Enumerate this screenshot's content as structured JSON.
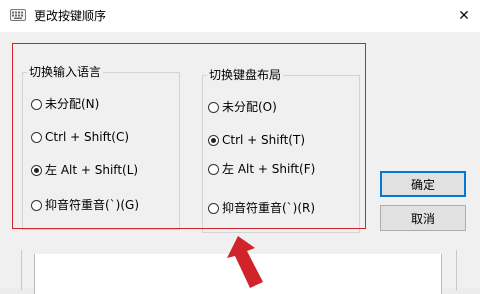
{
  "window": {
    "title": "更改按键顺序",
    "close_glyph": "✕"
  },
  "input_language_group": {
    "legend": "切换输入语言",
    "options": [
      {
        "label": "未分配(N)",
        "checked": false
      },
      {
        "label": "Ctrl + Shift(C)",
        "checked": false
      },
      {
        "label": "左 Alt + Shift(L)",
        "checked": true
      },
      {
        "label": "抑音符重音(`)(G)",
        "checked": false
      }
    ]
  },
  "keyboard_layout_group": {
    "legend": "切换键盘布局",
    "options": [
      {
        "label": "未分配(O)",
        "checked": false
      },
      {
        "label": "Ctrl + Shift(T)",
        "checked": true
      },
      {
        "label": "左 Alt + Shift(F)",
        "checked": false
      },
      {
        "label": "抑音符重音(`)(R)",
        "checked": false
      }
    ]
  },
  "buttons": {
    "ok": "确定",
    "cancel": "取消"
  },
  "colors": {
    "highlight_border": "#d0242a",
    "arrow": "#d0242a",
    "primary_button_border": "#0078d7"
  }
}
